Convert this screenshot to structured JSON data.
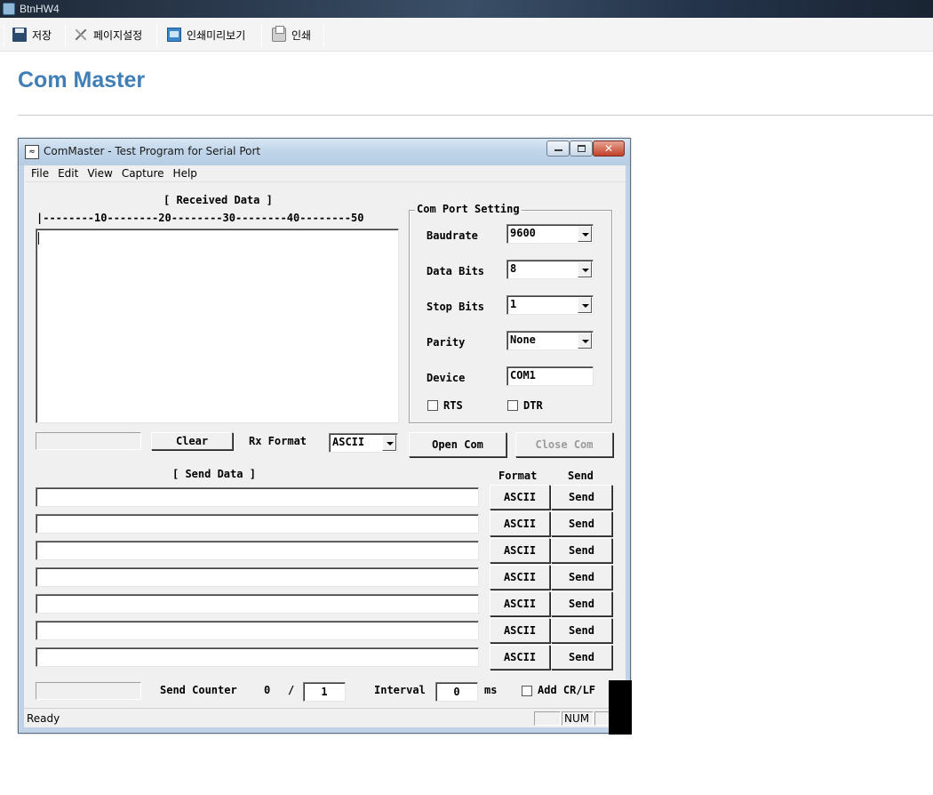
{
  "window": {
    "title": "BtnHW4"
  },
  "toolbar": {
    "save_label": "저장",
    "page_setup_label": "페이지설정",
    "print_preview_label": "인쇄미리보기",
    "print_label": "인쇄"
  },
  "page": {
    "title": "Com Master"
  },
  "app": {
    "title": "ComMaster - Test Program for Serial Port",
    "menu": [
      "File",
      "Edit",
      "View",
      "Capture",
      "Help"
    ],
    "received": {
      "header": "[ Received Data ]",
      "ruler": "|--------10--------20--------30--------40--------50",
      "clear_label": "Clear",
      "rx_format_label": "Rx Format",
      "rx_format_value": "ASCII"
    },
    "com_port": {
      "title": "Com Port Setting",
      "baudrate_label": "Baudrate",
      "baudrate_value": "9600",
      "data_bits_label": "Data Bits",
      "data_bits_value": "8",
      "stop_bits_label": "Stop Bits",
      "stop_bits_value": "1",
      "parity_label": "Parity",
      "parity_value": "None",
      "device_label": "Device",
      "device_value": "COM1",
      "rts_label": "RTS",
      "dtr_label": "DTR",
      "rts_checked": false,
      "dtr_checked": false
    },
    "open_com_label": "Open Com",
    "close_com_label": "Close Com",
    "send": {
      "header": "[ Send Data ]",
      "format_header": "Format",
      "send_header": "Send",
      "rows": [
        {
          "value": "",
          "format": "ASCII",
          "send": "Send"
        },
        {
          "value": "",
          "format": "ASCII",
          "send": "Send"
        },
        {
          "value": "",
          "format": "ASCII",
          "send": "Send"
        },
        {
          "value": "",
          "format": "ASCII",
          "send": "Send"
        },
        {
          "value": "",
          "format": "ASCII",
          "send": "Send"
        },
        {
          "value": "",
          "format": "ASCII",
          "send": "Send"
        },
        {
          "value": "",
          "format": "ASCII",
          "send": "Send"
        }
      ]
    },
    "counter": {
      "label": "Send Counter",
      "count": "0",
      "slash": "/",
      "total": "1",
      "interval_label": "Interval",
      "interval_value": "0",
      "interval_unit": "ms",
      "add_crlf_label": "Add CR/LF",
      "add_crlf_checked": false
    },
    "status": {
      "ready": "Ready",
      "num": "NUM"
    }
  }
}
